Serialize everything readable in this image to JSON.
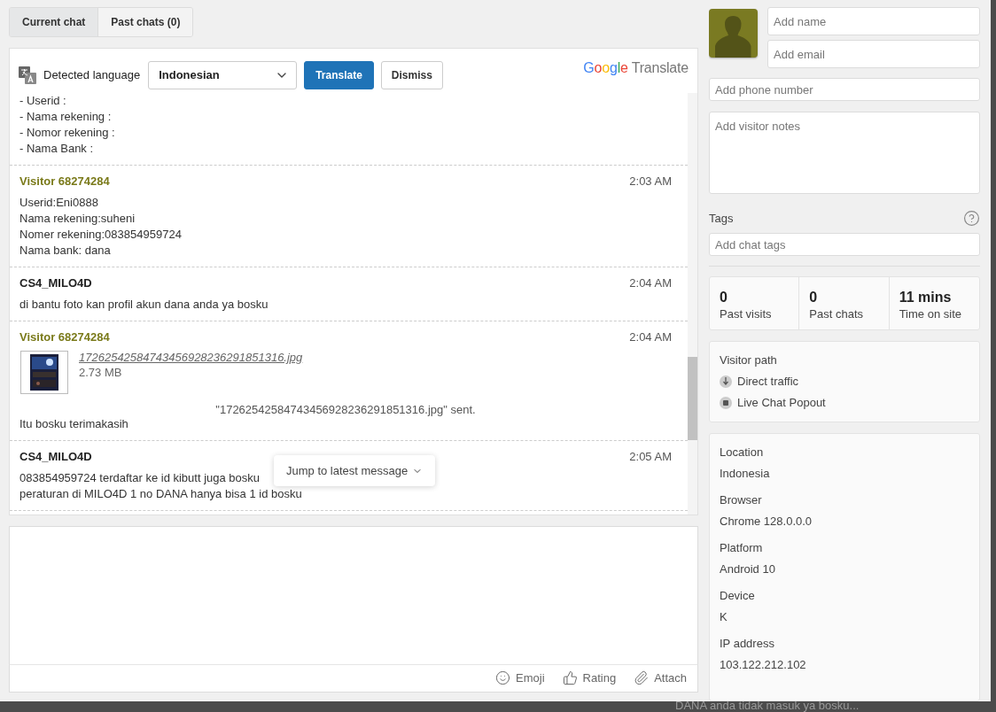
{
  "tabs": [
    {
      "label": "Current chat",
      "selected": true
    },
    {
      "label": "Past chats (0)",
      "selected": false
    }
  ],
  "translate_bar": {
    "label": "Detected language",
    "language": "Indonesian",
    "translate_button": "Translate",
    "dismiss_button": "Dismiss",
    "brand": {
      "google": "Google",
      "product": "Translate"
    }
  },
  "messages": [
    {
      "lines": [
        "- Userid :",
        "- Nama rekening :",
        "- Nomor rekening :",
        "- Nama Bank :"
      ]
    },
    {
      "kind": "visitor",
      "author": "Visitor 68274284",
      "time": "2:03 AM",
      "lines": [
        "Userid:Eni0888",
        "Nama rekening:suheni",
        "Nomer rekening:083854959724",
        "Nama bank: dana"
      ]
    },
    {
      "kind": "agent",
      "author": "CS4_MILO4D",
      "time": "2:04 AM",
      "lines": [
        "di bantu foto kan profil akun dana anda ya bosku"
      ]
    },
    {
      "kind": "visitor",
      "author": "Visitor 68274284",
      "time": "2:04 AM",
      "file": {
        "name": "17262542584743456928236291851316.jpg",
        "size": "2.73 MB",
        "notice": "\"17262542584743456928236291851316.jpg\" sent."
      },
      "lines": [
        "Itu bosku terimakasih"
      ]
    },
    {
      "kind": "agent",
      "author": "CS4_MILO4D",
      "time": "2:05 AM",
      "lines": [
        "083854959724 terdaftar ke id kibutt juga bosku",
        "peraturan di MILO4D 1 no DANA hanya bisa 1 id bosku"
      ]
    }
  ],
  "jump_button": "Jump to latest message",
  "composer": {
    "actions": [
      {
        "kind": "emoji",
        "label": "Emoji"
      },
      {
        "kind": "rating",
        "label": "Rating"
      },
      {
        "kind": "attach",
        "label": "Attach"
      }
    ]
  },
  "visitor": {
    "name_placeholder": "Add name",
    "email_placeholder": "Add email",
    "phone_placeholder": "Add phone number",
    "notes_placeholder": "Add visitor notes",
    "tags_label": "Tags",
    "tags_placeholder": "Add chat tags"
  },
  "stats": [
    {
      "value": "0",
      "label": "Past visits"
    },
    {
      "value": "0",
      "label": "Past chats"
    },
    {
      "value": "11 mins",
      "label": "Time on site"
    }
  ],
  "visitor_path": {
    "title": "Visitor path",
    "items": [
      {
        "kind": "arrival",
        "label": "Direct traffic"
      },
      {
        "kind": "page",
        "label": "Live Chat Popout"
      }
    ]
  },
  "details": [
    {
      "label": "Location",
      "value": "Indonesia"
    },
    {
      "label": "Browser",
      "value": "Chrome 128.0.0.0"
    },
    {
      "label": "Platform",
      "value": "Android 10"
    },
    {
      "label": "Device",
      "value": "K"
    },
    {
      "label": "IP address",
      "value": "103.122.212.102"
    }
  ],
  "background_text": "DANA anda tidak masuk ya bosku..."
}
